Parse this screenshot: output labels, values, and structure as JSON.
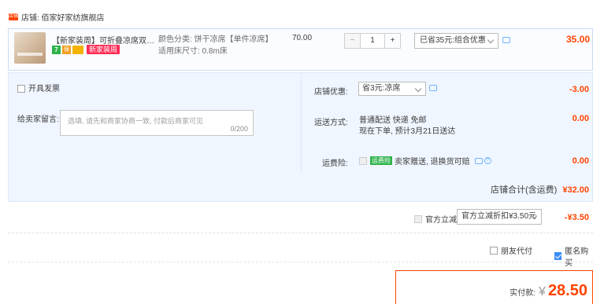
{
  "shop": {
    "icon_text": "店铺",
    "label": "店铺: 佰家好家纺旗舰店"
  },
  "item": {
    "title": "【新家装周】可折叠凉席双面凉...",
    "badge_new": "新家装周",
    "sku_color": "颜色分类: 饼干凉席【单件凉席】",
    "sku_size": "适用床尺寸: 0.8m床",
    "unit_price": "70.00",
    "quantity": "1",
    "minus": "−",
    "plus": "+",
    "promo_select": "已省35元:组合优惠",
    "total": "35.00"
  },
  "left_panel": {
    "invoice_label": "开具发票",
    "message_label": "给卖家留言:",
    "message_placeholder": "选填, 请先和商家协商一致, 付款后商家可见",
    "message_counter": "0/200"
  },
  "right_panel": {
    "coupon_label": "店铺优惠:",
    "coupon_select": "省3元:凉席",
    "coupon_amount": "-3.00",
    "shipping_label": "运送方式:",
    "shipping_line1": "普通配送 快递 免邮",
    "shipping_line2": "现在下单, 预计3月21日送达",
    "shipping_amount": "0.00",
    "insurance_label": "运费险:",
    "insurance_badge": "运费险",
    "insurance_text": "卖家赠送, 退换货可赔",
    "insurance_amount": "0.00"
  },
  "shop_total": {
    "label": "店铺合计(含运费)",
    "value": "¥32.00"
  },
  "official_discount": {
    "label": "官方立减",
    "select": "官方立减折扣¥3.50元",
    "amount": "-¥3.50"
  },
  "options": {
    "friend_pay": "朋友代付",
    "anonymous": "匿名购买"
  },
  "payment": {
    "label": "实付款:",
    "currency": "¥",
    "amount": "28.50"
  }
}
